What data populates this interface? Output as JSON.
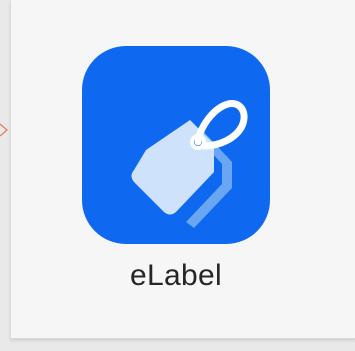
{
  "app": {
    "name": "eLabel",
    "icon": "tag-icon",
    "tile_color": "#0e69f0",
    "tag_color": "#cfe2fb",
    "tag_shadow_color": "#6aa6f4"
  }
}
